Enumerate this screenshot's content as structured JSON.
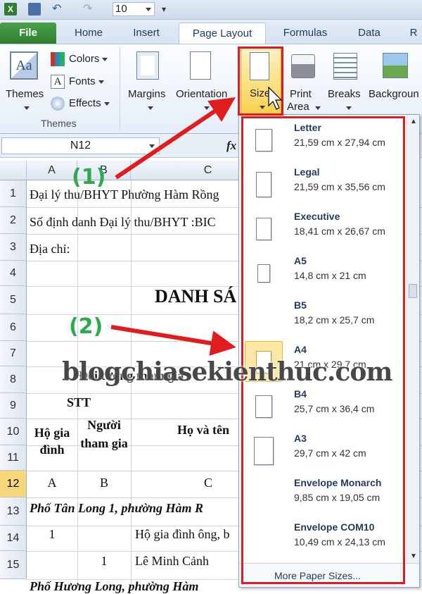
{
  "qat": {
    "font_size_value": "10"
  },
  "tabs": [
    {
      "label": "File"
    },
    {
      "label": "Home"
    },
    {
      "label": "Insert"
    },
    {
      "label": "Page Layout"
    },
    {
      "label": "Formulas"
    },
    {
      "label": "Data"
    },
    {
      "label": "R"
    }
  ],
  "ribbon": {
    "themes_label": "Themes",
    "colors_label": "Colors",
    "fonts_label": "Fonts",
    "effects_label": "Effects",
    "themes_group_label": "Themes",
    "margins_label": "Margins",
    "orientation_label": "Orientation",
    "size_label": "Size",
    "print_area_label_1": "Print",
    "print_area_label_2": "Area",
    "breaks_label": "Breaks",
    "background_label": "Backgroun"
  },
  "formula_bar": {
    "name_box": "N12",
    "fx": "fx"
  },
  "columns": [
    "A",
    "B",
    "C"
  ],
  "rows": [
    "1",
    "2",
    "3",
    "4",
    "5",
    "6",
    "7",
    "8",
    "9",
    "10",
    "11",
    "12",
    "13",
    "14",
    "15"
  ],
  "cells": {
    "r1": "Đại lý thu/BHYT Phường Hàm Rồng",
    "r2": "Số định danh Đại lý thu/BHYT :BIC",
    "r3": "Địa chỉ:",
    "r5": "DANH SÁ",
    "r8": "Đối tượng tham gia",
    "r9_stt": "STT",
    "r10_a": "Hộ gia đình",
    "r10_b": "Người tham gia",
    "r10_c": "Họ và tên",
    "r12_a": "A",
    "r12_b": "B",
    "r12_c": "C",
    "r13": "Phố Tân Long 1, phường Hàm R",
    "r14_a": "1",
    "r14_c": "Hộ gia đình ông, b",
    "r15_b": "1",
    "r15_c": "Lê Minh Cảnh",
    "r16": "Phố Hương Long, phường Hàm"
  },
  "paper_sizes": [
    {
      "name": "Letter",
      "dims": "21,59 cm x 27,94 cm"
    },
    {
      "name": "Legal",
      "dims": "21,59 cm x 35,56 cm"
    },
    {
      "name": "Executive",
      "dims": "18,41 cm x 26,67 cm"
    },
    {
      "name": "A5",
      "dims": "14,8 cm x 21 cm"
    },
    {
      "name": "B5",
      "dims": "18,2 cm x 25,7 cm"
    },
    {
      "name": "A4",
      "dims": "21 cm x 29,7 cm"
    },
    {
      "name": "B4",
      "dims": "25,7 cm x 36,4 cm"
    },
    {
      "name": "A3",
      "dims": "29,7 cm x 42 cm"
    },
    {
      "name": "Envelope Monarch",
      "dims": "9,85 cm x 19,05 cm"
    },
    {
      "name": "Envelope COM10",
      "dims": "10,49 cm x 24,13 cm"
    }
  ],
  "selected_paper": "A4",
  "more_paper_sizes": "More Paper Sizes...",
  "annotations": {
    "step1": "(1)",
    "step2": "(2)"
  },
  "watermark": "blogchiasekienthuc.com",
  "colors": {
    "file_tab": "#2f7d2f",
    "highlight": "#f7d77a",
    "annotation_red": "#e11c1c",
    "annotation_green": "#2eaa4f"
  }
}
